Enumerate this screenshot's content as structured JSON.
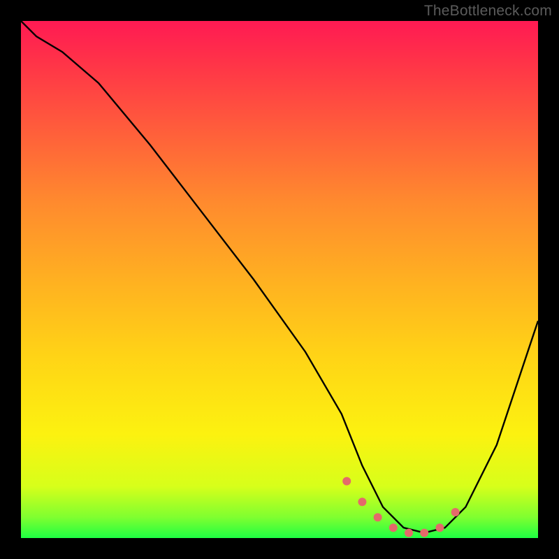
{
  "watermark": "TheBottleneck.com",
  "chart_data": {
    "type": "line",
    "title": "",
    "xlabel": "",
    "ylabel": "",
    "xlim": [
      0,
      100
    ],
    "ylim": [
      0,
      100
    ],
    "series": [
      {
        "name": "bottleneck-curve",
        "x": [
          0,
          3,
          8,
          15,
          25,
          35,
          45,
          55,
          62,
          66,
          70,
          74,
          78,
          82,
          86,
          92,
          100
        ],
        "values": [
          100,
          97,
          94,
          88,
          76,
          63,
          50,
          36,
          24,
          14,
          6,
          2,
          1,
          2,
          6,
          18,
          42
        ]
      }
    ],
    "markers": {
      "name": "highlight-band",
      "x": [
        63,
        66,
        69,
        72,
        75,
        78,
        81,
        84
      ],
      "values": [
        11,
        7,
        4,
        2,
        1,
        1,
        2,
        5
      ]
    },
    "gradient_stops": [
      {
        "pos": 0,
        "color": "#ff1a53"
      },
      {
        "pos": 8,
        "color": "#ff3348"
      },
      {
        "pos": 20,
        "color": "#ff5a3c"
      },
      {
        "pos": 35,
        "color": "#ff8a2e"
      },
      {
        "pos": 50,
        "color": "#ffb021"
      },
      {
        "pos": 65,
        "color": "#ffd416"
      },
      {
        "pos": 80,
        "color": "#fcf210"
      },
      {
        "pos": 90,
        "color": "#d7ff1a"
      },
      {
        "pos": 96,
        "color": "#7fff30"
      },
      {
        "pos": 100,
        "color": "#1eff43"
      }
    ],
    "colors": {
      "curve": "#000000",
      "marker": "#e46a6a",
      "background": "#000000"
    }
  }
}
